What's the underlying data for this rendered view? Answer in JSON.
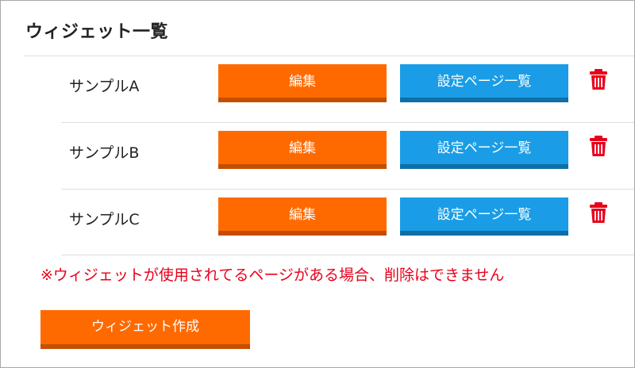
{
  "page": {
    "title": "ウィジェット一覧"
  },
  "widgets": [
    {
      "name": "サンプルA",
      "edit_label": "編集",
      "settings_label": "設定ページ一覧",
      "delete_icon": "trash-icon"
    },
    {
      "name": "サンプルB",
      "edit_label": "編集",
      "settings_label": "設定ページ一覧",
      "delete_icon": "trash-icon"
    },
    {
      "name": "サンプルC",
      "edit_label": "編集",
      "settings_label": "設定ページ一覧",
      "delete_icon": "trash-icon"
    }
  ],
  "notice": "※ウィジェットが使用されてるページがある場合、削除はできません",
  "create_button": {
    "label": "ウィジェット作成"
  },
  "colors": {
    "edit_button": "#ff6a00",
    "edit_button_shadow": "#c44f00",
    "settings_button": "#1a9de6",
    "settings_button_shadow": "#0f6fa6",
    "delete_icon": "#e8001a",
    "notice_text": "#e8001a"
  }
}
